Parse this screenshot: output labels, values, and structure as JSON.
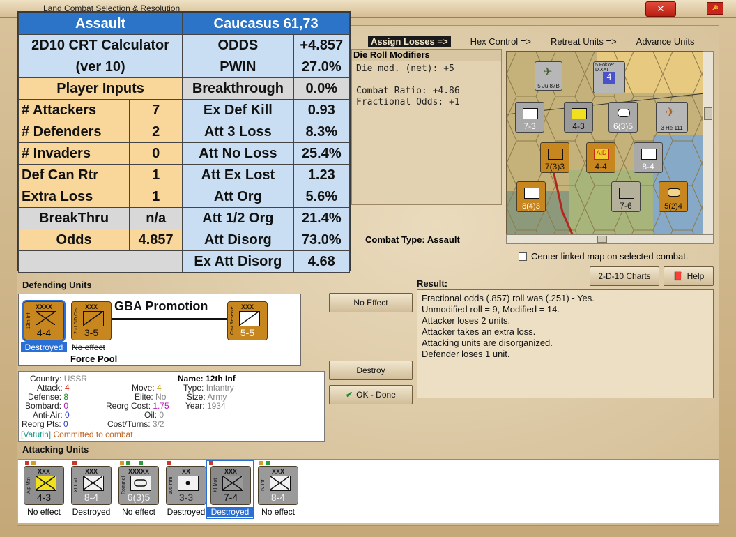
{
  "window": {
    "title": "Land Combat Selection & Resolution",
    "close_glyph": "✕",
    "flag_glyph": "☭"
  },
  "phase_tabs": [
    "Assign Losses =>",
    "Hex Control =>",
    "Retreat Units =>",
    "Advance Units"
  ],
  "drm": {
    "heading": "Die Roll Modifiers",
    "lines": [
      "Die mod. (net): +5",
      "",
      "Combat Ratio: +4.86",
      "Fractional Odds: +1"
    ]
  },
  "crt": {
    "title_left": "Assault",
    "title_right": "Caucasus 61,73",
    "calc_name": "2D10 CRT Calculator",
    "calc_ver": "(ver 10)",
    "inputs_header": "Player Inputs",
    "inputs": [
      {
        "label": "# Attackers",
        "value": "7"
      },
      {
        "label": "# Defenders",
        "value": "2"
      },
      {
        "label": "# Invaders",
        "value": "0"
      },
      {
        "label": "Def Can Rtr",
        "value": "1"
      },
      {
        "label": "Extra Loss",
        "value": "1"
      },
      {
        "label": "BreakThru",
        "value": "n/a"
      },
      {
        "label": "Odds",
        "value": "4.857"
      }
    ],
    "results": [
      {
        "label": "ODDS",
        "value": "+4.857"
      },
      {
        "label": "PWIN",
        "value": "27.0%"
      },
      {
        "label": "Breakthrough",
        "value": "0.0%"
      },
      {
        "label": "Ex Def Kill",
        "value": "0.93"
      },
      {
        "label": "Att 3 Loss",
        "value": "8.3%"
      },
      {
        "label": "Att No Loss",
        "value": "25.4%"
      },
      {
        "label": "Att Ex Lost",
        "value": "1.23"
      },
      {
        "label": "Att Org",
        "value": "5.6%"
      },
      {
        "label": "Att 1/2 Org",
        "value": "21.4%"
      },
      {
        "label": "Att Disorg",
        "value": "73.0%"
      },
      {
        "label": "Ex Att Disorg",
        "value": "4.68"
      }
    ]
  },
  "combat_type": "Combat Type:  Assault",
  "center_linked": "Center linked map on selected combat.",
  "buttons": {
    "charts": "2-D-10 Charts",
    "help": "Help",
    "no_effect": "No Effect",
    "destroy": "Destroy",
    "ok_done": "OK - Done"
  },
  "defending": {
    "label": "Defending Units",
    "gba": "GBA Promotion",
    "force_pool": "Force Pool",
    "units": [
      {
        "side": "12th Inf",
        "size": "XXXX",
        "str": "4-4",
        "caption": "Destroyed"
      },
      {
        "side": "2nd GD Cav",
        "size": "XXX",
        "str": "3-5",
        "caption": "No effect"
      },
      {
        "side": "Cav Reserve",
        "size": "XXX",
        "str": "5-5",
        "caption": ""
      }
    ]
  },
  "unit_info": {
    "country_k": "Country:",
    "country_v": "USSR",
    "attack_k": "Attack:",
    "attack_v": "4",
    "defense_k": "Defense:",
    "defense_v": "8",
    "bombard_k": "Bombard:",
    "bombard_v": "0",
    "antiair_k": "Anti-Air:",
    "antiair_v": "0",
    "reorgpts_k": "Reorg Pts:",
    "reorgpts_v": "0",
    "move_k": "Move:",
    "move_v": "4",
    "elite_k": "Elite:",
    "elite_v": "No",
    "reorgcost_k": "Reorg Cost:",
    "reorgcost_v": "1.75",
    "oil_k": "Oil:",
    "oil_v": "0",
    "costturns_k": "Cost/Turns:",
    "costturns_v": "3/2",
    "name_k": "Name:",
    "name_v": "12th Inf",
    "type_k": "Type:",
    "type_v": "Infantry",
    "size_k": "Size:",
    "size_v": "Army",
    "year_k": "Year:",
    "year_v": "1934",
    "status_a": "[Vatutin]",
    "status_b": "Committed to combat"
  },
  "result": {
    "label": "Result:",
    "lines": [
      "Fractional odds (.857) roll was (.251)  - Yes.",
      "Unmodified roll = 9, Modified = 14.",
      "Attacker loses 2 units.",
      "Attacker takes an extra loss.",
      "Attacking units are disorganized.",
      "Defender loses 1 unit."
    ]
  },
  "attacking": {
    "label": "Attacking Units",
    "units": [
      {
        "side": "Alp Mtn",
        "size": "XXX",
        "str": "4-3",
        "caption": "No effect"
      },
      {
        "side": "XIII Inf",
        "size": "XXX",
        "str": "8-4",
        "caption": "Destroyed"
      },
      {
        "side": "Rommel",
        "size": "XXXXX",
        "str": "6(3)5",
        "caption": "No effect"
      },
      {
        "side": "105 mm",
        "size": "XX",
        "str": "3-3",
        "caption": "Destroyed"
      },
      {
        "side": "XI Mot",
        "size": "XXX",
        "str": "7-4",
        "caption": "Destroyed"
      },
      {
        "side": "IV Inf",
        "size": "XXX",
        "str": "8-4",
        "caption": "No effect"
      }
    ]
  },
  "map_counters": [
    {
      "label": "7-3"
    },
    {
      "label": "4-3"
    },
    {
      "label": "6(3)5"
    },
    {
      "label": "3 He 111"
    },
    {
      "label": "7(3)3"
    },
    {
      "label": "4-4"
    },
    {
      "label": "8-4"
    },
    {
      "label": "7-6"
    },
    {
      "label": "8(4)3"
    },
    {
      "label": "5(2)4"
    },
    {
      "label": "5 Ju 87B"
    },
    {
      "label": "5 Fokker D.XXI"
    }
  ],
  "colors": {
    "accent_blue": "#2b74c7",
    "peach": "#f9d69a",
    "light_blue": "#c9def2"
  }
}
